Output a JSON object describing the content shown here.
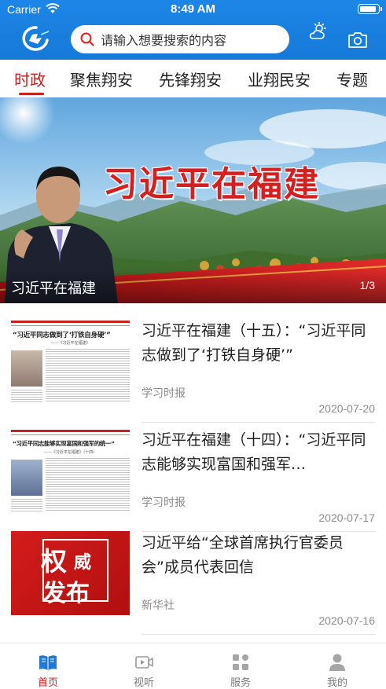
{
  "status_bar": {
    "carrier": "Carrier",
    "time": "8:49 AM"
  },
  "header": {
    "logo_icon": "app-logo-icon",
    "search": {
      "placeholder": "请输入想要搜索的内容",
      "icon": "search-icon"
    },
    "weather_icon": "weather-icon",
    "camera_icon": "camera-icon",
    "accent": "#1679d8"
  },
  "tabs": [
    {
      "label": "时政",
      "active": true
    },
    {
      "label": "聚焦翔安",
      "active": false
    },
    {
      "label": "先锋翔安",
      "active": false
    },
    {
      "label": "业翔民安",
      "active": false
    },
    {
      "label": "专题",
      "active": false
    }
  ],
  "banner": {
    "headline": "习近平在福建",
    "caption": "习近平在福建",
    "pager": "1/3"
  },
  "news": [
    {
      "title": "习近平在福建（十五）：“习近平同志做到了‘打铁自身硬’”",
      "source": "学习时报",
      "date": "2020-07-20",
      "thumb_headline": "“习近平同志做到了‘打铁自身硬’”",
      "thumb_sub": "——《习近平在福建》"
    },
    {
      "title": "习近平在福建（十四）：“习近平同志能够实现富国和强军…",
      "source": "学习时报",
      "date": "2020-07-17",
      "thumb_headline": "“习近平同志能够实现富国和强军的统一”",
      "thumb_sub": "——《习近平在福建》（十四）"
    },
    {
      "title": "习近平给“全球首席执行官委员会”成员代表回信",
      "source": "新华社",
      "date": "2020-07-16",
      "thumb_text": {
        "w1": "权",
        "w2": "威",
        "w3": "发布"
      }
    }
  ],
  "tabbar": [
    {
      "label": "首页",
      "icon": "book-icon",
      "active": true
    },
    {
      "label": "视听",
      "icon": "video-icon",
      "active": false
    },
    {
      "label": "服务",
      "icon": "grid-icon",
      "active": false
    },
    {
      "label": "我的",
      "icon": "person-icon",
      "active": false
    }
  ],
  "colors": {
    "brand_red": "#c81f1f",
    "header_blue": "#1679d8"
  }
}
